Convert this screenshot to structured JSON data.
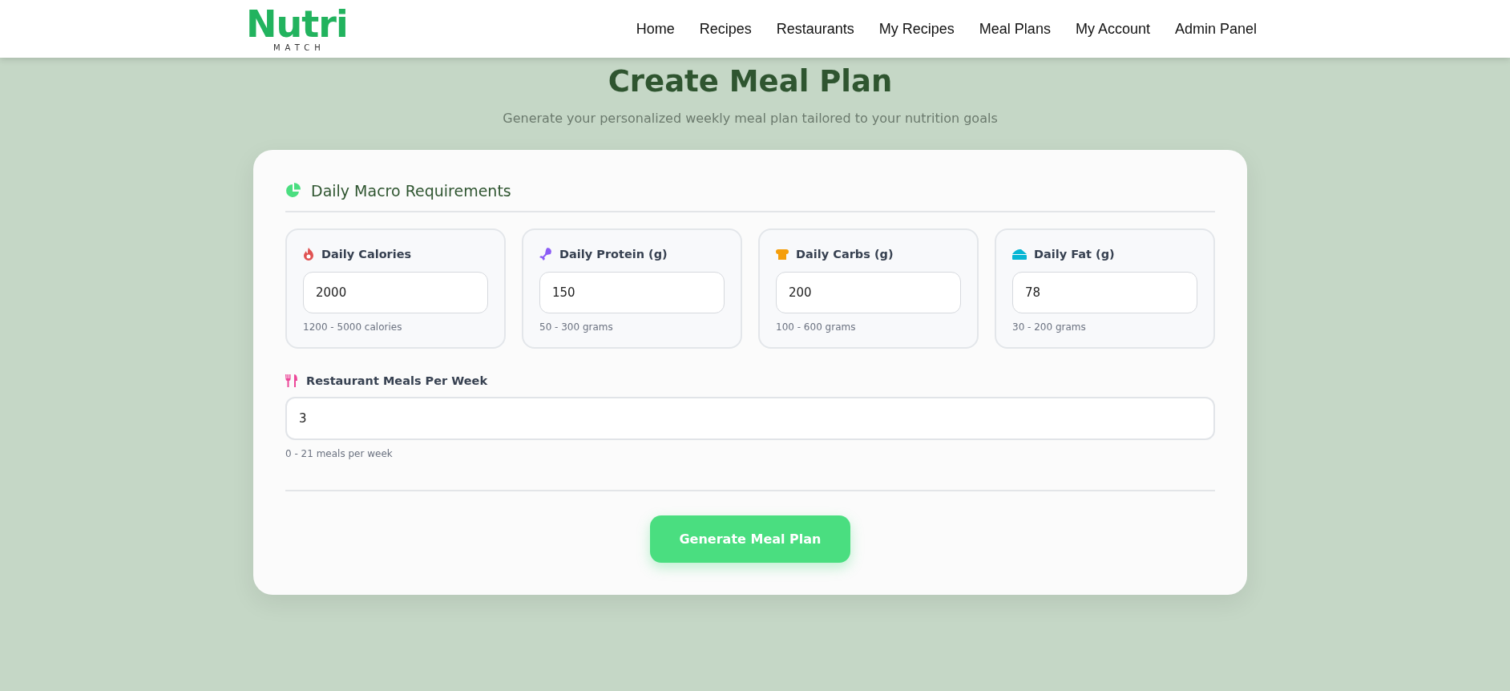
{
  "logo": {
    "name": "Nutri",
    "tagline": "MATCH"
  },
  "nav": [
    "Home",
    "Recipes",
    "Restaurants",
    "My Recipes",
    "Meal Plans",
    "My Account",
    "Admin Panel"
  ],
  "header": {
    "title": "Create Meal Plan",
    "subtitle": "Generate your personalized weekly meal plan tailored to your nutrition goals"
  },
  "section": {
    "title": "Daily Macro Requirements"
  },
  "macros": [
    {
      "kind": "calories",
      "label": "Daily Calories",
      "value": "2000",
      "hint": "1200 - 5000 calories"
    },
    {
      "kind": "protein",
      "label": "Daily Protein (g)",
      "value": "150",
      "hint": "50 - 300 grams"
    },
    {
      "kind": "carbs",
      "label": "Daily Carbs (g)",
      "value": "200",
      "hint": "100 - 600 grams"
    },
    {
      "kind": "fat",
      "label": "Daily Fat (g)",
      "value": "78",
      "hint": "30 - 200 grams"
    }
  ],
  "restaurant_meals": {
    "label": "Restaurant Meals Per Week",
    "value": "3",
    "hint": "0 - 21 meals per week"
  },
  "submit": "Generate Meal Plan"
}
